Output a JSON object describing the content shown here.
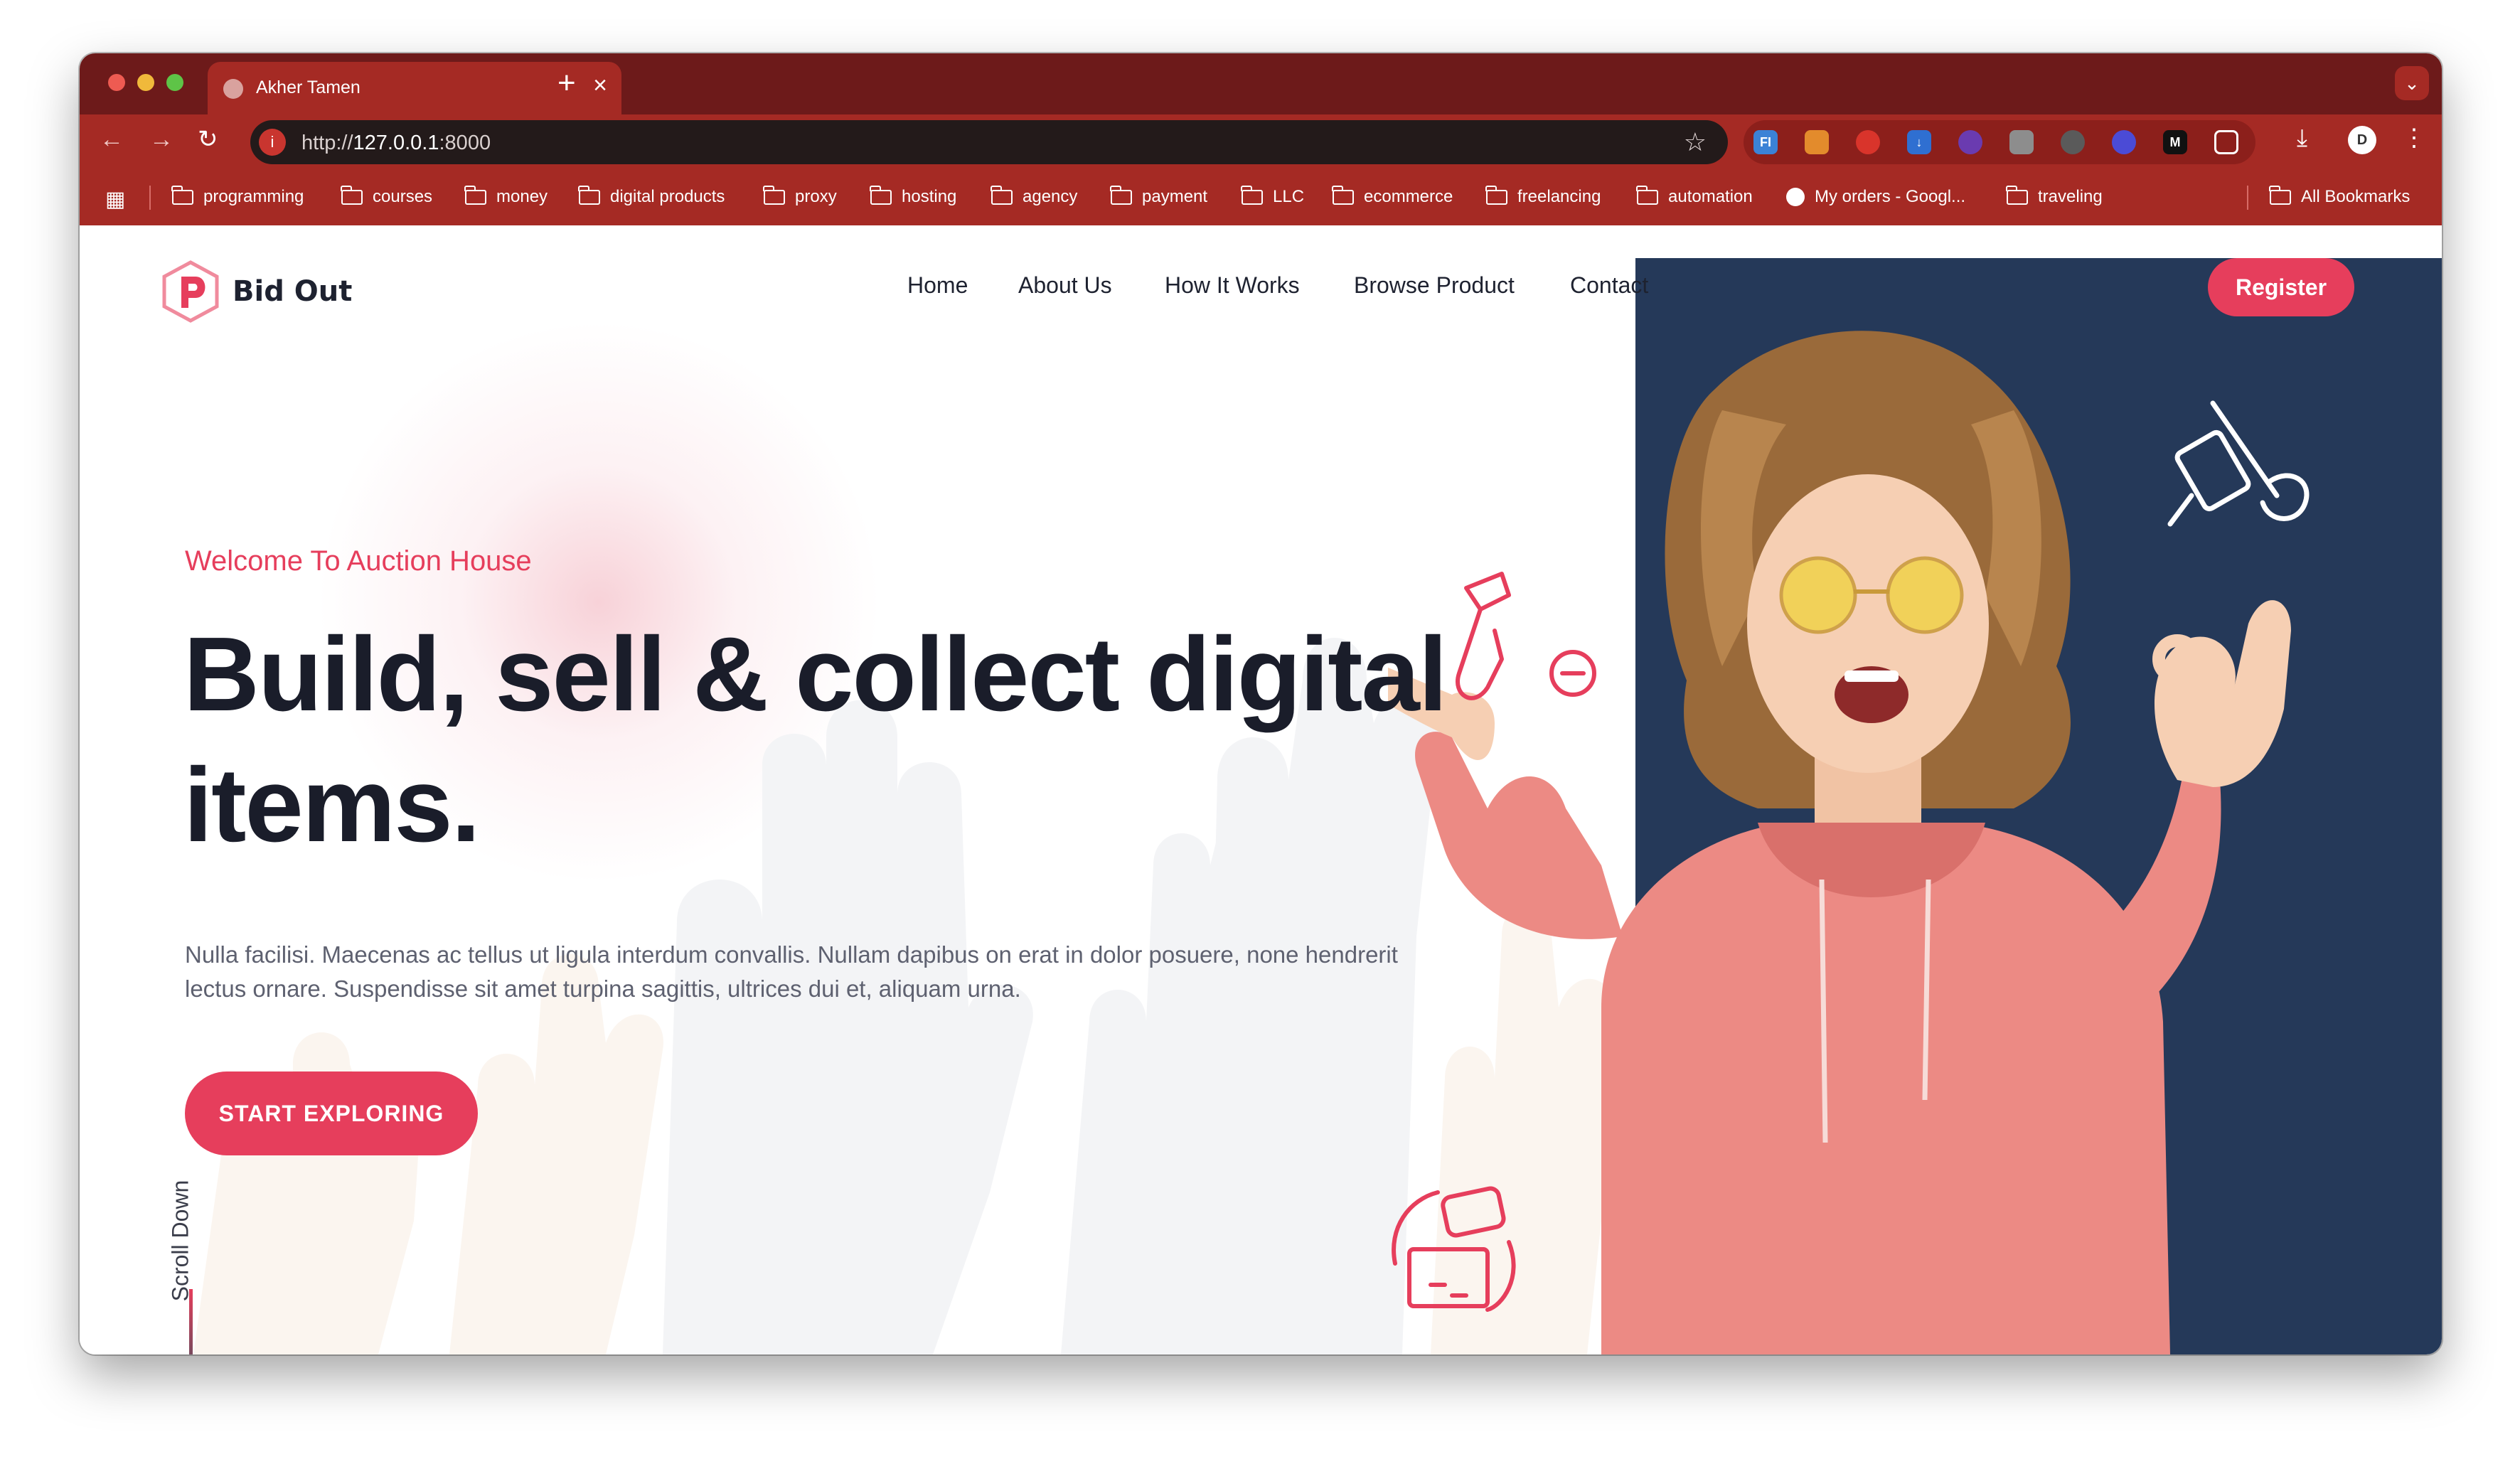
{
  "browser": {
    "tab_title": "Akher Tamen",
    "url_prefix": "http://",
    "url_host": "127.0.0.1",
    "url_port": ":8000",
    "bookmarks": [
      "programming",
      "courses",
      "money",
      "digital products",
      "proxy",
      "hosting",
      "agency",
      "payment",
      "LLC",
      "ecommerce",
      "freelancing",
      "automation",
      "My orders - Googl...",
      "traveling"
    ],
    "all_bookmarks": "All Bookmarks",
    "extension_badges": [
      "FI",
      "M"
    ],
    "avatar_letter": "D"
  },
  "site": {
    "brand": "Bid Out",
    "nav": [
      "Home",
      "About Us",
      "How It Works",
      "Browse Product",
      "Contact"
    ],
    "register_label": "Register"
  },
  "hero": {
    "kicker": "Welcome To Auction House",
    "headline": "Build, sell & collect digital items.",
    "description": "Nulla facilisi. Maecenas ac tellus ut ligula interdum convallis. Nullam dapibus on erat in dolor posuere, none hendrerit lectus ornare. Suspendisse sit amet turpina sagittis, ultrices dui et, aliquam urna.",
    "cta_label": "START EXPLORING",
    "scroll_label": "Scroll Down"
  },
  "colors": {
    "accent": "#e63e5c",
    "tabbar": "#6d1a1a",
    "toolbar": "#a52a24",
    "hero_panel": "#253959",
    "hoodie": "#e8827b"
  }
}
